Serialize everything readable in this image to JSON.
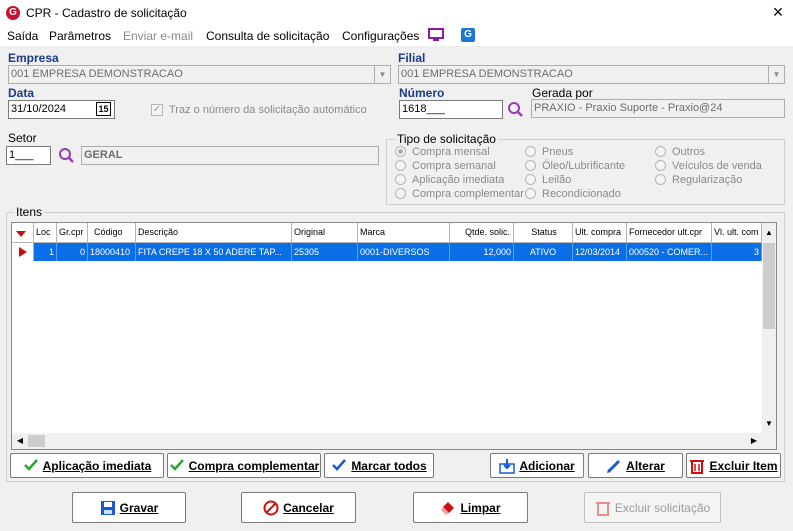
{
  "window": {
    "title": "CPR - Cadastro de solicitação",
    "close": "×",
    "app_icon": "G"
  },
  "menu": {
    "items": [
      "Saída",
      "Parâmetros",
      "Enviar e-mail",
      "Consulta de solicitação",
      "Configurações"
    ]
  },
  "empresa": {
    "label": "Empresa",
    "value": "001 EMPRESA DEMONSTRACAO"
  },
  "filial": {
    "label": "Filial",
    "value": "001 EMPRESA DEMONSTRACAO"
  },
  "data": {
    "label": "Data",
    "value": "31/10/2024",
    "cal": "15"
  },
  "auto_num": {
    "label": "Traz o número da solicitação automático",
    "checked": true
  },
  "numero": {
    "label": "Número",
    "value": "1618___"
  },
  "gerada": {
    "label": "Gerada por",
    "value": "PRAXIO - Praxio Suporte - Praxio@24"
  },
  "setor": {
    "label": "Setor",
    "code": "1___",
    "name": "GERAL"
  },
  "tipo": {
    "label": "Tipo de solicitação",
    "options": [
      "Compra mensal",
      "Compra semanal",
      "Aplicação imediata",
      "Compra complementar",
      "Pneus",
      "Óleo/Lubrificante",
      "Leilão",
      "Recondicionado",
      "Outros",
      "Veículos de venda",
      "Regularização"
    ]
  },
  "itens": {
    "label": "Itens",
    "columns": [
      "Loc",
      "Gr.cpr",
      "Código",
      "Descrição",
      "Original",
      "Marca",
      "Qtde. solic.",
      "Status",
      "Ult. compra",
      "Fornecedor ult.cpr",
      "Vl. ult. com"
    ],
    "rows": [
      [
        "1",
        "0",
        "18000410",
        "FITA CREPE 18 X 50 ADERE TAP...",
        "25305",
        "0001-DIVERSOS",
        "12,000",
        "ATIVO",
        "12/03/2014",
        "000520 - COMER...",
        "3"
      ]
    ]
  },
  "buttons": {
    "aplicacao": "Aplicação imediata",
    "compra": "Compra complementar",
    "marcar": "Marcar todos",
    "adicionar": "Adicionar",
    "alterar": "Alterar",
    "excluir_item": "Excluir Item",
    "gravar": "Gravar",
    "cancelar": "Cancelar",
    "limpar": "Limpar",
    "excluir_sol": "Excluir solicitação"
  },
  "colors": {
    "accent": "#0a6ee6",
    "label_blue": "#1a3a8a",
    "brand_red": "#c8102e"
  }
}
